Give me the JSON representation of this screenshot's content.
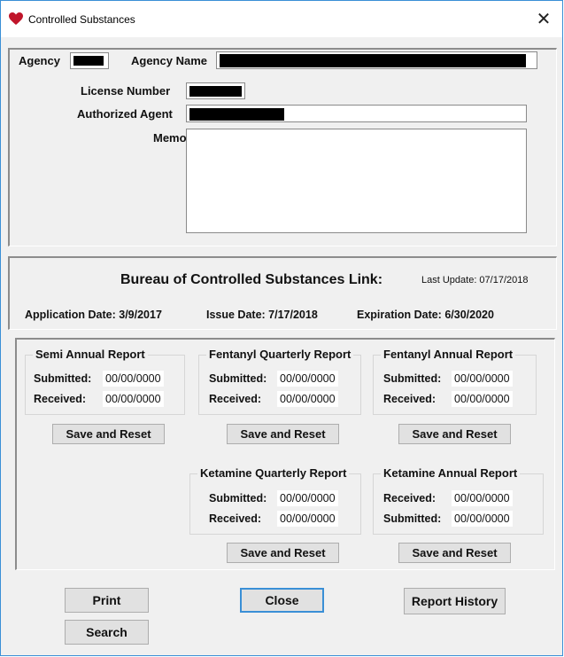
{
  "window": {
    "title": "Controlled Substances",
    "close_glyph": "✕",
    "icon": "heart-icon"
  },
  "agency": {
    "agency_label": "Agency",
    "agency_name_label": "Agency Name",
    "license_label": "License Number",
    "agent_label": "Authorized Agent",
    "memo_label": "Memo"
  },
  "bureau": {
    "title": "Bureau of Controlled Substances Link:",
    "last_update": "Last Update:  07/17/2018",
    "application_date": "Application Date: 3/9/2017",
    "issue_date": "Issue Date: 7/17/2018",
    "expiration_date": "Expiration Date: 6/30/2020"
  },
  "reports": {
    "semi_annual": {
      "title": "Semi Annual Report",
      "row1_label": "Submitted:",
      "row1_value": "00/00/0000",
      "row2_label": "Received:",
      "row2_value": "00/00/0000",
      "button": "Save and Reset"
    },
    "fentanyl_quarterly": {
      "title": "Fentanyl Quarterly Report",
      "row1_label": "Submitted:",
      "row1_value": "00/00/0000",
      "row2_label": "Received:",
      "row2_value": "00/00/0000",
      "button": "Save and Reset"
    },
    "fentanyl_annual": {
      "title": "Fentanyl Annual Report",
      "row1_label": "Submitted:",
      "row1_value": "00/00/0000",
      "row2_label": "Received:",
      "row2_value": "00/00/0000",
      "button": "Save and Reset"
    },
    "ketamine_quarterly": {
      "title": "Ketamine Quarterly Report",
      "row1_label": "Submitted:",
      "row1_value": "00/00/0000",
      "row2_label": "Received:",
      "row2_value": "00/00/0000",
      "button": "Save and Reset"
    },
    "ketamine_annual": {
      "title": "Ketamine Annual Report",
      "row1_label": "Received:",
      "row1_value": "00/00/0000",
      "row2_label": "Submitted:",
      "row2_value": "00/00/0000",
      "button": "Save and Reset"
    }
  },
  "footer": {
    "print": "Print",
    "search": "Search",
    "close": "Close",
    "report_history": "Report History"
  },
  "colors": {
    "accent": "#3a8fd6",
    "window_bg": "#f0f0f0",
    "heart": "#c0152a"
  }
}
